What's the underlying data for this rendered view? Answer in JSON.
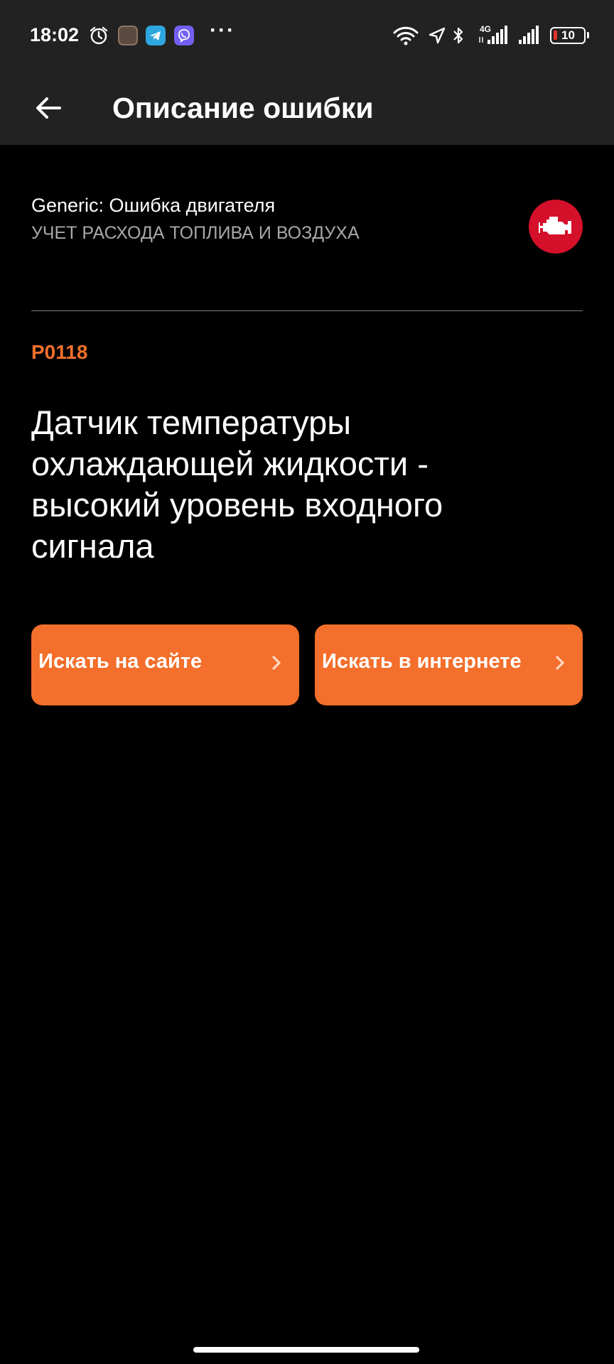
{
  "status_bar": {
    "time": "18:02",
    "network_label": "4G",
    "battery_level": "10",
    "overflow": "···"
  },
  "app_bar": {
    "title": "Описание ошибки"
  },
  "error": {
    "category": "Generic: Ошибка двигателя",
    "subcategory": "УЧЕТ РАСХОДА ТОПЛИВА И ВОЗДУХА",
    "code": "P0118",
    "description": "Датчик температуры охлаждающей жидкости - высокий уровень входного сигнала"
  },
  "actions": {
    "search_site_label": "Искать на сайте",
    "search_internet_label": "Искать в интернете"
  },
  "colors": {
    "accent": "#f36f2b",
    "code_text": "#f2702b",
    "badge": "#d4102a",
    "bar_background": "#222222",
    "background": "#000000"
  },
  "icons": {
    "back": "arrow-left-icon",
    "engine": "check-engine-icon",
    "chevron": "chevron-right-icon"
  }
}
